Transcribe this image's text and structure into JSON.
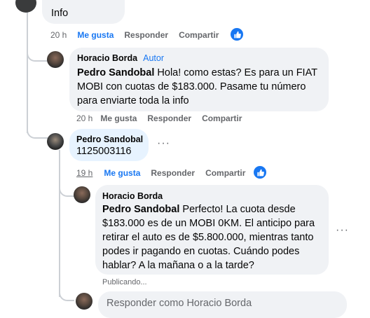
{
  "top_comment": {
    "text": "Info",
    "time": "20 h",
    "like": "Me gusta",
    "reply": "Responder",
    "share": "Compartir"
  },
  "reply1": {
    "author": "Horacio Borda",
    "badge": "Autor",
    "mention": "Pedro Sandobal",
    "text": " Hola! como estas? Es para un FIAT MOBI con cuotas de $183.000. Pasame tu número para enviarte toda la info",
    "time": "20 h",
    "like": "Me gusta",
    "reply": "Responder",
    "share": "Compartir"
  },
  "reply2": {
    "author": "Pedro Sandobal",
    "text": "1125003116",
    "time": "19 h",
    "like": "Me gusta",
    "reply": "Responder",
    "share": "Compartir"
  },
  "reply3": {
    "author": "Horacio Borda",
    "mention": "Pedro Sandobal",
    "text": " Perfecto! La cuota desde $183.000 es de un MOBI 0KM. El anticipo para retirar el auto es de $5.800.000, mientras tanto podes ir pagando en cuotas. Cuándo podes hablar? A la mañana o a la tarde?",
    "status": "Publicando..."
  },
  "composer": {
    "placeholder": "Responder como Horacio Borda"
  },
  "colors": {
    "accent": "#1877f2",
    "bubble": "#f0f2f5",
    "bubble_highlight": "#e7f3ff",
    "muted": "#65676b"
  },
  "icons": {
    "like": "thumbs-up-icon",
    "more": "more-options-icon"
  }
}
